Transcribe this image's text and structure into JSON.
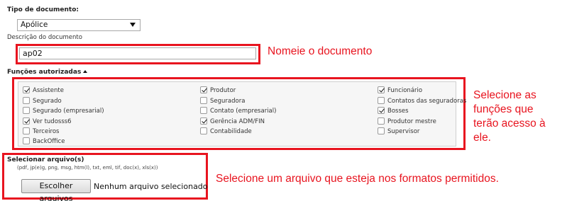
{
  "doc_type": {
    "label": "Tipo de documento:",
    "selected": "Apólice"
  },
  "description": {
    "label": "Descrição do documento",
    "value": "ap02"
  },
  "functions": {
    "label": "Funções autorizadas",
    "roles": [
      {
        "label": "Assistente",
        "checked": true
      },
      {
        "label": "Segurado",
        "checked": false
      },
      {
        "label": "Segurado (empresarial)",
        "checked": false
      },
      {
        "label": "Ver tudosss6",
        "checked": true
      },
      {
        "label": "Terceiros",
        "checked": false
      },
      {
        "label": "BackOffice",
        "checked": false
      },
      {
        "label": "Produtor",
        "checked": true
      },
      {
        "label": "Seguradora",
        "checked": false
      },
      {
        "label": "Contato (empresarial)",
        "checked": false
      },
      {
        "label": "Gerência ADM/FIN",
        "checked": true
      },
      {
        "label": "Contabilidade",
        "checked": false
      },
      {
        "label": "Funcionário",
        "checked": true
      },
      {
        "label": "Contatos das seguradoras",
        "checked": false
      },
      {
        "label": "Bosses",
        "checked": true
      },
      {
        "label": "Produtor mestre",
        "checked": false
      },
      {
        "label": "Supervisor",
        "checked": false
      }
    ]
  },
  "file": {
    "label": "Selecionar arquivo(s)",
    "formats": "(pdf, jp(e)g, png, msg, htm(l), txt, eml, tif, doc(x), xls(x))",
    "button": "Escolher arquivos",
    "status": "Nenhum arquivo selecionado"
  },
  "annotations": {
    "name_doc": "Nomeie o documento",
    "select_functions": [
      "Selecione as",
      "funções que",
      "terão acesso à",
      "ele."
    ],
    "select_file": "Selecione um arquivo que esteja nos formatos permitidos."
  },
  "colors": {
    "annotation": "#e8141f"
  }
}
